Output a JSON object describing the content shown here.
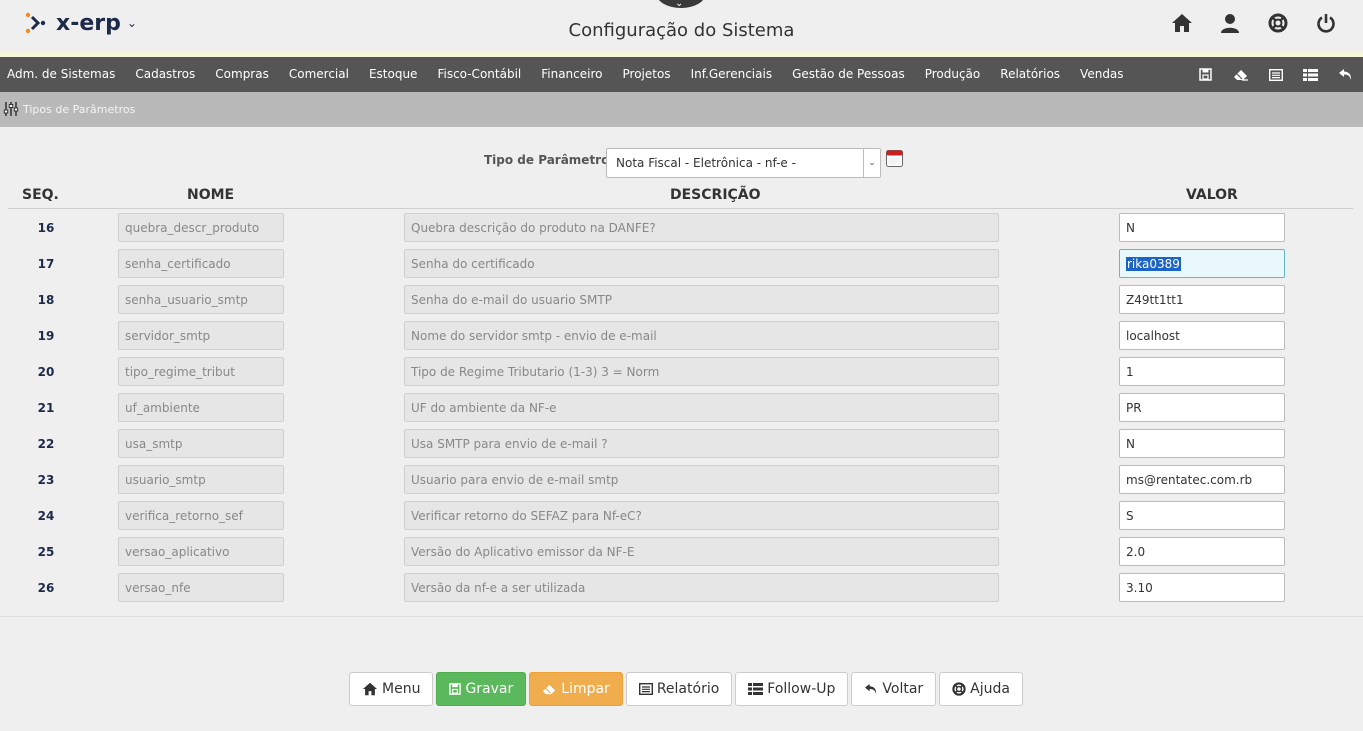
{
  "app": {
    "logo_text": "x-erp",
    "logo_caret": "⌄",
    "page_title": "Configuração do Sistema"
  },
  "top_icons": [
    "home-icon",
    "user-icon",
    "lifebuoy-icon",
    "power-icon"
  ],
  "menu": {
    "items": [
      "Adm. de Sistemas",
      "Cadastros",
      "Compras",
      "Comercial",
      "Estoque",
      "Fisco-Contábil",
      "Financeiro",
      "Projetos",
      "Inf.Gerenciais",
      "Gestão de Pessoas",
      "Produção",
      "Relatórios",
      "Vendas"
    ],
    "tools": [
      "save-icon",
      "eraser-icon",
      "list-icon",
      "table-icon",
      "undo-icon"
    ]
  },
  "breadcrumb": {
    "label": "Tipos de Parâmetros"
  },
  "form": {
    "tipo_label": "Tipo de Parâmetro",
    "tipo_value": "Nota Fiscal - Eletrônica - nf-e -"
  },
  "table": {
    "headers": {
      "seq": "SEQ.",
      "nome": "NOME",
      "descricao": "DESCRIÇÃO",
      "valor": "VALOR"
    },
    "rows": [
      {
        "seq": "16",
        "nome": "quebra_descr_produto",
        "descricao": "Quebra descrição do produto na DANFE?",
        "valor": "N"
      },
      {
        "seq": "17",
        "nome": "senha_certificado",
        "descricao": "Senha do certificado",
        "valor": "rika0389"
      },
      {
        "seq": "18",
        "nome": "senha_usuario_smtp",
        "descricao": "Senha do e-mail do usuario SMTP",
        "valor": "Z49tt1tt1"
      },
      {
        "seq": "19",
        "nome": "servidor_smtp",
        "descricao": "Nome do servidor smtp - envio de e-mail",
        "valor": "localhost"
      },
      {
        "seq": "20",
        "nome": "tipo_regime_tribut",
        "descricao": "Tipo de Regime Tributario (1-3) 3 = Norm",
        "valor": "1"
      },
      {
        "seq": "21",
        "nome": "uf_ambiente",
        "descricao": "UF do ambiente da NF-e",
        "valor": "PR"
      },
      {
        "seq": "22",
        "nome": "usa_smtp",
        "descricao": "Usa SMTP para envio de e-mail ?",
        "valor": "N"
      },
      {
        "seq": "23",
        "nome": "usuario_smtp",
        "descricao": "Usuario para envio de e-mail smtp",
        "valor": "ms@rentatec.com.rb"
      },
      {
        "seq": "24",
        "nome": "verifica_retorno_sef",
        "descricao": "Verificar retorno do SEFAZ para Nf-eC?",
        "valor": "S"
      },
      {
        "seq": "25",
        "nome": "versao_aplicativo",
        "descricao": "Versão do Aplicativo emissor da NF-E",
        "valor": "2.0"
      },
      {
        "seq": "26",
        "nome": "versao_nfe",
        "descricao": "Versão da nf-e a ser utilizada",
        "valor": "3.10"
      }
    ]
  },
  "buttons": {
    "menu": "Menu",
    "gravar": "Gravar",
    "limpar": "Limpar",
    "relatorio": "Relatório",
    "followup": "Follow-Up",
    "voltar": "Voltar",
    "ajuda": "Ajuda"
  },
  "colors": {
    "menubar": "#555555",
    "gravar": "#5cb85c",
    "limpar": "#f0ad4e",
    "logo": "#1d2a4a"
  }
}
